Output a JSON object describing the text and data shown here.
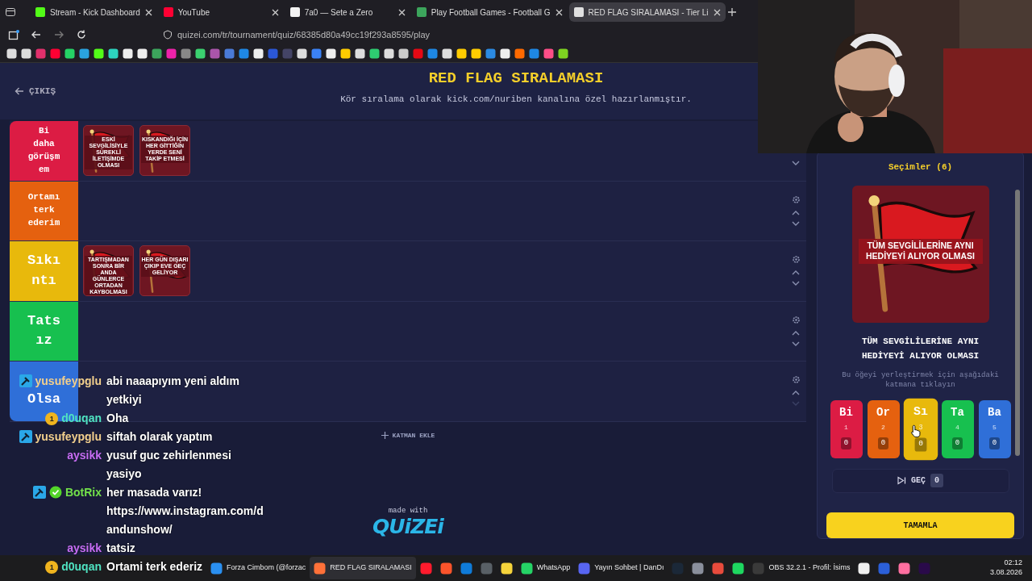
{
  "browser": {
    "tabs": [
      {
        "title": "Stream - Kick Dashboard",
        "selected": false
      },
      {
        "title": "YouTube",
        "selected": false
      },
      {
        "title": "7a0 — Sete a Zero",
        "selected": false
      },
      {
        "title": "Play Football Games - Football G",
        "selected": false
      },
      {
        "title": "RED FLAG SIRALAMASI - Tier Li",
        "selected": true
      }
    ],
    "url": "quizei.com/tr/tournament/quiz/68385d80a49cc19f293a8595/play"
  },
  "header": {
    "back": "ÇIKIŞ",
    "title": "RED FLAG SIRALAMASI",
    "subtitle": "Kör sıralama olarak kick.com/nuriben kanalına özel hazırlanmıştır."
  },
  "tiers": [
    {
      "label": "Bi daha görüşmem",
      "color": "#dc1c44",
      "settings_visible": false,
      "can_move_up": false,
      "can_move_down": true,
      "items": [
        {
          "text": "ESKİ SEVGİLİSİYLE SÜREKLİ İLETİŞİMDE OLMASI"
        },
        {
          "text": "KISKANDIĞI İÇİN HER GİTTİĞİN YERDE SENİ TAKİP ETMESİ"
        }
      ]
    },
    {
      "label": "Ortamı terk ederim",
      "color": "#e5610f",
      "settings_visible": true,
      "can_move_up": true,
      "can_move_down": true
    },
    {
      "label": "Sıkıntı",
      "color": "#e8b90c",
      "settings_visible": true,
      "can_move_up": true,
      "can_move_down": true,
      "items": [
        {
          "text": "TARTIŞMADAN SONRA BİR ANDA GÜNLERCE ORTADAN KAYBOLMASI"
        },
        {
          "text": "HER GÜN DIŞARI ÇIKIP EVE GEÇ GELİYOR"
        }
      ]
    },
    {
      "label": "Tatsız",
      "color": "#17c04f",
      "settings_visible": true,
      "can_move_up": true,
      "can_move_down": true
    },
    {
      "label": "Olsa",
      "color": "#2f6fd8",
      "settings_visible": true,
      "can_move_up": true,
      "can_move_down": false
    }
  ],
  "add_tier": "KATMAN EKLE",
  "brand": {
    "tagline": "made with",
    "logo": "QUiZEi"
  },
  "picks": {
    "title": "Seçimler (6)",
    "image_text": "TÜM SEVGİLİLERİNE AYNI HEDİYEYİ ALIYOR OLMASI",
    "caption": "TÜM SEVGİLİLERİNE AYNI HEDİYEYİ ALIYOR OLMASI",
    "hint": "Bu öğeyi yerleştirmek için aşağıdaki katmana tıklayın",
    "targets": [
      {
        "abbr": "Bi",
        "number": "1",
        "count": "0",
        "color": "#dc1c44",
        "hovered": false
      },
      {
        "abbr": "Or",
        "number": "2",
        "count": "0",
        "color": "#e5610f",
        "hovered": false
      },
      {
        "abbr": "Sı",
        "number": "3",
        "count": "0",
        "color": "#e8b90c",
        "hovered": true
      },
      {
        "abbr": "Ta",
        "number": "4",
        "count": "0",
        "color": "#17c04f",
        "hovered": false
      },
      {
        "abbr": "Ba",
        "number": "5",
        "count": "0",
        "color": "#2f6fd8",
        "hovered": false
      }
    ],
    "skip": {
      "label": "GEÇ",
      "count": "0"
    },
    "done": "TAMAMLA"
  },
  "chat": [
    {
      "user": "yusufeypglu",
      "color": "#f2cf8c",
      "badges": [
        {
          "kind": "moderator"
        }
      ],
      "text": "abi naaapıyım yeni aldım yetkiyi"
    },
    {
      "user": "d0uqan",
      "color": "#4fe3c1",
      "badges": [
        {
          "kind": "gifter",
          "text": "1"
        }
      ],
      "text": "Oha"
    },
    {
      "user": "yusufeypglu",
      "color": "#f2cf8c",
      "badges": [
        {
          "kind": "moderator"
        }
      ],
      "text": "siftah olarak yaptım"
    },
    {
      "user": "aysikk",
      "color": "#c76cf2",
      "text": "yusuf guc zehirlenmesi yasiyo"
    },
    {
      "user": "BotRix",
      "color": "#72e04a",
      "badges": [
        {
          "kind": "moderator"
        },
        {
          "kind": "verified"
        }
      ],
      "text": "her masada varız! https://www.instagram.com/dandunshow/"
    },
    {
      "user": "aysikk",
      "color": "#c76cf2",
      "text": "tatsiz"
    },
    {
      "user": "d0uqan",
      "color": "#4fe3c1",
      "badges": [
        {
          "kind": "gifter",
          "text": "1"
        }
      ],
      "text": "Ortami terk ederiz"
    }
  ],
  "taskbar": {
    "items": [
      {
        "label": "Forza Cimbom (@forzac",
        "active": false
      },
      {
        "label": "RED FLAG SIRALAMASI",
        "active": true
      },
      {
        "active": false
      },
      {
        "active": false
      },
      {
        "active": false
      },
      {
        "active": false
      },
      {
        "active": false
      },
      {
        "label": "WhatsApp",
        "active": false
      },
      {
        "label": "Yayın Sohbet | DanDı",
        "active": false
      },
      {
        "active": false
      },
      {
        "active": false
      },
      {
        "active": false
      },
      {
        "active": false
      },
      {
        "label": "OBS 32.2.1 - Profil: İsims",
        "active": false
      },
      {
        "active": false
      },
      {
        "active": false
      },
      {
        "active": false
      },
      {
        "active": false
      }
    ],
    "time": "02:12",
    "date": "3.08.2026"
  }
}
